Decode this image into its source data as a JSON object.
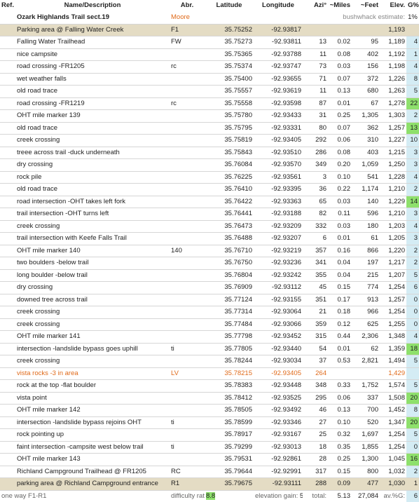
{
  "headers": {
    "ref": "Ref.",
    "name": "Name/Description",
    "abr": "Abr.",
    "lat": "Latitude",
    "lon": "Longitude",
    "azi": "Azi°",
    "miles": "~Miles",
    "feet": "~Feet",
    "elev": "Elev.",
    "grade": "G%"
  },
  "title_row": {
    "title": "Ozark Highlands Trail sect.19",
    "author": "Moore",
    "bushwhack_label": "bushwhack estimate:",
    "bushwhack_value": "1%"
  },
  "rows": [
    {
      "name": "Parking area @ Falling Water Creek",
      "abr": "F1",
      "lat": "35.75252",
      "lon": "-92.93817",
      "azi": "",
      "miles": "",
      "feet": "",
      "elev": "1,193",
      "g": "",
      "style": "tan"
    },
    {
      "name": "Falling Water Trailhead",
      "abr": "FW",
      "lat": "35.75273",
      "lon": "-92.93811",
      "azi": "13",
      "miles": "0.02",
      "feet": "95",
      "elev": "1,189",
      "g": "4",
      "style": ""
    },
    {
      "name": "nice campsite",
      "abr": "",
      "lat": "35.75365",
      "lon": "-92.93788",
      "azi": "11",
      "miles": "0.08",
      "feet": "402",
      "elev": "1,192",
      "g": "1",
      "style": ""
    },
    {
      "name": "road crossing -FR1205",
      "abr": "rc",
      "lat": "35.75374",
      "lon": "-92.93747",
      "azi": "73",
      "miles": "0.03",
      "feet": "156",
      "elev": "1,198",
      "g": "4",
      "style": ""
    },
    {
      "name": "wet weather falls",
      "abr": "",
      "lat": "35.75400",
      "lon": "-92.93655",
      "azi": "71",
      "miles": "0.07",
      "feet": "372",
      "elev": "1,226",
      "g": "8",
      "style": ""
    },
    {
      "name": "old road trace",
      "abr": "",
      "lat": "35.75557",
      "lon": "-92.93619",
      "azi": "11",
      "miles": "0.13",
      "feet": "680",
      "elev": "1,263",
      "g": "5",
      "style": ""
    },
    {
      "name": "road crossing -FR1219",
      "abr": "rc",
      "lat": "35.75558",
      "lon": "-92.93598",
      "azi": "87",
      "miles": "0.01",
      "feet": "67",
      "elev": "1,278",
      "g": "22",
      "style": "",
      "green": true
    },
    {
      "name": "OHT mile marker 139",
      "abr": "",
      "lat": "35.75780",
      "lon": "-92.93433",
      "azi": "31",
      "miles": "0.25",
      "feet": "1,305",
      "elev": "1,303",
      "g": "2",
      "style": ""
    },
    {
      "name": "old road trace",
      "abr": "",
      "lat": "35.75795",
      "lon": "-92.93331",
      "azi": "80",
      "miles": "0.07",
      "feet": "362",
      "elev": "1,257",
      "g": "13",
      "style": "",
      "green": true
    },
    {
      "name": "creek crossing",
      "abr": "",
      "lat": "35.75819",
      "lon": "-92.93405",
      "azi": "292",
      "miles": "0.06",
      "feet": "310",
      "elev": "1,227",
      "g": "10",
      "style": ""
    },
    {
      "name": "treee across trail -duck underneath",
      "abr": "",
      "lat": "35.75843",
      "lon": "-92.93510",
      "azi": "286",
      "miles": "0.08",
      "feet": "403",
      "elev": "1,215",
      "g": "3",
      "style": ""
    },
    {
      "name": "dry crossing",
      "abr": "",
      "lat": "35.76084",
      "lon": "-92.93570",
      "azi": "349",
      "miles": "0.20",
      "feet": "1,059",
      "elev": "1,250",
      "g": "3",
      "style": ""
    },
    {
      "name": "rock pile",
      "abr": "",
      "lat": "35.76225",
      "lon": "-92.93561",
      "azi": "3",
      "miles": "0.10",
      "feet": "541",
      "elev": "1,228",
      "g": "4",
      "style": ""
    },
    {
      "name": "old road trace",
      "abr": "",
      "lat": "35.76410",
      "lon": "-92.93395",
      "azi": "36",
      "miles": "0.22",
      "feet": "1,174",
      "elev": "1,210",
      "g": "2",
      "style": ""
    },
    {
      "name": "road intersection -OHT takes left fork",
      "abr": "",
      "lat": "35.76422",
      "lon": "-92.93363",
      "azi": "65",
      "miles": "0.03",
      "feet": "140",
      "elev": "1,229",
      "g": "14",
      "style": "",
      "green": true
    },
    {
      "name": "trail intersection -OHT turns left",
      "abr": "",
      "lat": "35.76441",
      "lon": "-92.93188",
      "azi": "82",
      "miles": "0.11",
      "feet": "596",
      "elev": "1,210",
      "g": "3",
      "style": ""
    },
    {
      "name": "creek crossing",
      "abr": "",
      "lat": "35.76473",
      "lon": "-92.93209",
      "azi": "332",
      "miles": "0.03",
      "feet": "180",
      "elev": "1,203",
      "g": "4",
      "style": ""
    },
    {
      "name": "trail intersection with Keefe Falls Trail",
      "abr": "",
      "lat": "35.76488",
      "lon": "-92.93207",
      "azi": "6",
      "miles": "0.01",
      "feet": "61",
      "elev": "1,205",
      "g": "3",
      "style": ""
    },
    {
      "name": "OHT mile marker 140",
      "abr": "140",
      "lat": "35.76710",
      "lon": "-92.93219",
      "azi": "357",
      "miles": "0.16",
      "feet": "866",
      "elev": "1,220",
      "g": "2",
      "style": ""
    },
    {
      "name": "two boulders -below trail",
      "abr": "",
      "lat": "35.76750",
      "lon": "-92.93236",
      "azi": "341",
      "miles": "0.04",
      "feet": "197",
      "elev": "1,217",
      "g": "2",
      "style": ""
    },
    {
      "name": "long boulder -below trail",
      "abr": "",
      "lat": "35.76804",
      "lon": "-92.93242",
      "azi": "355",
      "miles": "0.04",
      "feet": "215",
      "elev": "1,207",
      "g": "5",
      "style": ""
    },
    {
      "name": "dry crossing",
      "abr": "",
      "lat": "35.76909",
      "lon": "-92.93112",
      "azi": "45",
      "miles": "0.15",
      "feet": "774",
      "elev": "1,254",
      "g": "6",
      "style": ""
    },
    {
      "name": "downed tree across trail",
      "abr": "",
      "lat": "35.77124",
      "lon": "-92.93155",
      "azi": "351",
      "miles": "0.17",
      "feet": "913",
      "elev": "1,257",
      "g": "0",
      "style": ""
    },
    {
      "name": "creek crossing",
      "abr": "",
      "lat": "35.77314",
      "lon": "-92.93064",
      "azi": "21",
      "miles": "0.18",
      "feet": "966",
      "elev": "1,254",
      "g": "0",
      "style": ""
    },
    {
      "name": "creek crossing",
      "abr": "",
      "lat": "35.77484",
      "lon": "-92.93066",
      "azi": "359",
      "miles": "0.12",
      "feet": "625",
      "elev": "1,255",
      "g": "0",
      "style": ""
    },
    {
      "name": "OHT mile marker 141",
      "abr": "",
      "lat": "35.77798",
      "lon": "-92.93452",
      "azi": "315",
      "miles": "0.44",
      "feet": "2,306",
      "elev": "1,348",
      "g": "4",
      "style": ""
    },
    {
      "name": "intersection -landslide bypass goes uphill",
      "abr": "ti",
      "lat": "35.77805",
      "lon": "-92.93440",
      "azi": "54",
      "miles": "0.01",
      "feet": "62",
      "elev": "1,359",
      "g": "18",
      "style": "",
      "green": true
    },
    {
      "name": "creek crossing",
      "abr": "",
      "lat": "35.78244",
      "lon": "-92.93034",
      "azi": "37",
      "miles": "0.53",
      "feet": "2,821",
      "elev": "1,494",
      "g": "5",
      "style": ""
    },
    {
      "name": "vista rocks -3 in area",
      "abr": "LV",
      "lat": "35.78215",
      "lon": "-92.93405",
      "azi": "264",
      "miles": "",
      "feet": "",
      "elev": "1,429",
      "g": "",
      "style": "orange"
    },
    {
      "name": "rock at the top -flat boulder",
      "abr": "",
      "lat": "35.78383",
      "lon": "-92.93448",
      "azi": "348",
      "miles": "0.33",
      "feet": "1,752",
      "elev": "1,574",
      "g": "5",
      "style": ""
    },
    {
      "name": "vista point",
      "abr": "",
      "lat": "35.78412",
      "lon": "-92.93525",
      "azi": "295",
      "miles": "0.06",
      "feet": "337",
      "elev": "1,508",
      "g": "20",
      "style": "",
      "green": true
    },
    {
      "name": "OHT mile marker 142",
      "abr": "",
      "lat": "35.78505",
      "lon": "-92.93492",
      "azi": "46",
      "miles": "0.13",
      "feet": "700",
      "elev": "1,452",
      "g": "8",
      "style": ""
    },
    {
      "name": "intersection -landslide bypass rejoins OHT",
      "abr": "ti",
      "lat": "35.78599",
      "lon": "-92.93346",
      "azi": "27",
      "miles": "0.10",
      "feet": "520",
      "elev": "1,347",
      "g": "20",
      "style": "",
      "green": true
    },
    {
      "name": "rock pointing up",
      "abr": "",
      "lat": "35.78917",
      "lon": "-92.93167",
      "azi": "25",
      "miles": "0.32",
      "feet": "1,697",
      "elev": "1,254",
      "g": "5",
      "style": ""
    },
    {
      "name": "faint intersection -campsite west below trail",
      "abr": "ti",
      "lat": "35.79299",
      "lon": "-92.93013",
      "azi": "18",
      "miles": "0.35",
      "feet": "1,855",
      "elev": "1,254",
      "g": "0",
      "style": ""
    },
    {
      "name": "OHT mile marker 143",
      "abr": "",
      "lat": "35.79531",
      "lon": "-92.92861",
      "azi": "28",
      "miles": "0.25",
      "feet": "1,300",
      "elev": "1,045",
      "g": "16",
      "style": "",
      "green": true
    },
    {
      "name": "Richland Campground Trailhead @ FR1205",
      "abr": "RC",
      "lat": "35.79644",
      "lon": "-92.92991",
      "azi": "317",
      "miles": "0.15",
      "feet": "800",
      "elev": "1,032",
      "g": "2",
      "style": ""
    },
    {
      "name": "parking area @ Richland Campground entrance",
      "abr": "R1",
      "lat": "35.79675",
      "lon": "-92.93111",
      "azi": "288",
      "miles": "0.09",
      "feet": "477",
      "elev": "1,030",
      "g": "1",
      "style": "tan"
    }
  ],
  "footer": {
    "direction": "one way F1-R1",
    "difficulty_label": "difficulty rating:",
    "difficulty_value": "8.8",
    "gain_label": "elevation gain:",
    "gain_value": "560",
    "total_label": "total:",
    "total_miles": "5.13",
    "total_feet": "27,084",
    "avg_label": "av.%G:",
    "avg_value": "6"
  },
  "colors": {
    "tan": "#e4dcc4",
    "blue": "#d4ecf4",
    "green": "#8ee06c",
    "orange": "#e06a1a"
  }
}
